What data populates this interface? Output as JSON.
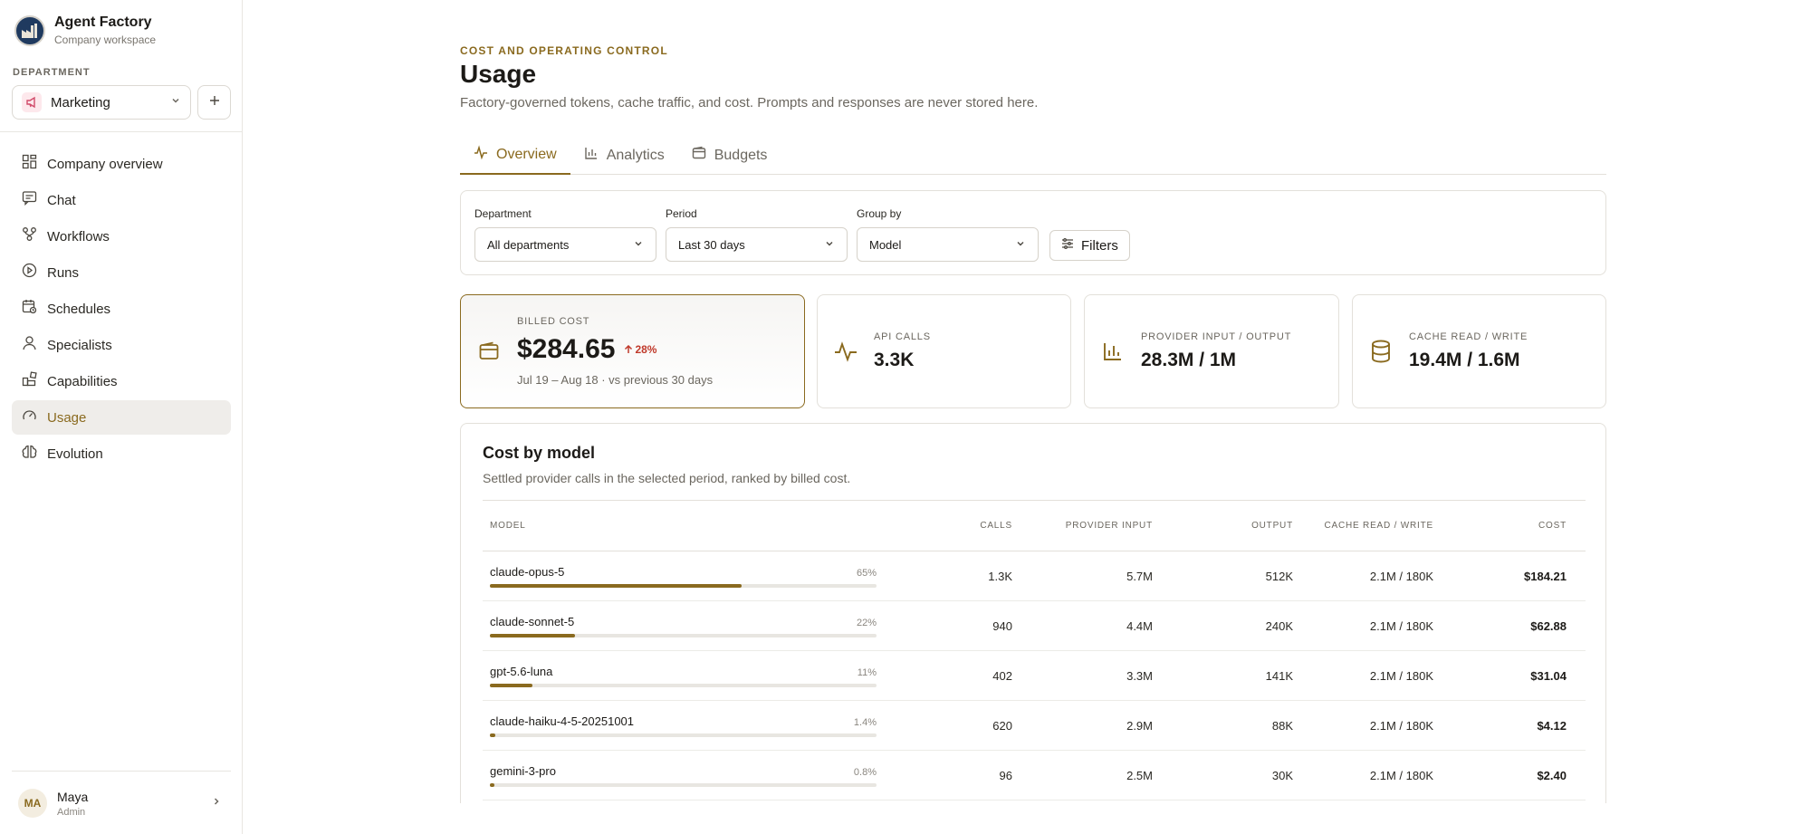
{
  "brand": {
    "name": "Agent Factory",
    "subtitle": "Company workspace"
  },
  "department": {
    "label": "DEPARTMENT",
    "selected": "Marketing"
  },
  "nav": [
    {
      "label": "Company overview",
      "icon": "grid-icon"
    },
    {
      "label": "Chat",
      "icon": "chat-icon"
    },
    {
      "label": "Workflows",
      "icon": "workflow-icon"
    },
    {
      "label": "Runs",
      "icon": "play-circle-icon"
    },
    {
      "label": "Schedules",
      "icon": "calendar-clock-icon"
    },
    {
      "label": "Specialists",
      "icon": "user-icon"
    },
    {
      "label": "Capabilities",
      "icon": "blocks-icon"
    },
    {
      "label": "Usage",
      "icon": "gauge-icon",
      "active": true
    },
    {
      "label": "Evolution",
      "icon": "brain-icon"
    }
  ],
  "user": {
    "initials": "MA",
    "name": "Maya",
    "role": "Admin"
  },
  "header": {
    "eyebrow": "COST AND OPERATING CONTROL",
    "title": "Usage",
    "subtitle": "Factory-governed tokens, cache traffic, and cost. Prompts and responses are never stored here."
  },
  "tabs": [
    {
      "label": "Overview",
      "icon": "activity-icon",
      "active": true
    },
    {
      "label": "Analytics",
      "icon": "bar-chart-icon"
    },
    {
      "label": "Budgets",
      "icon": "wallet-icon"
    }
  ],
  "filters": {
    "department": {
      "label": "Department",
      "value": "All departments"
    },
    "period": {
      "label": "Period",
      "value": "Last 30 days"
    },
    "group_by": {
      "label": "Group by",
      "value": "Model"
    },
    "button": "Filters"
  },
  "stats": {
    "billed": {
      "label": "BILLED COST",
      "value": "$284.65",
      "delta": "28%",
      "note": "Jul 19 – Aug 18 · vs previous 30 days"
    },
    "calls": {
      "label": "API CALLS",
      "value": "3.3K"
    },
    "provider": {
      "label": "PROVIDER INPUT / OUTPUT",
      "value": "28.3M / 1M"
    },
    "cache": {
      "label": "CACHE READ / WRITE",
      "value": "19.4M / 1.6M"
    }
  },
  "cost_table": {
    "title": "Cost by model",
    "subtitle": "Settled provider calls in the selected period, ranked by billed cost.",
    "columns": [
      "MODEL",
      "CALLS",
      "PROVIDER INPUT",
      "OUTPUT",
      "CACHE READ / WRITE",
      "COST"
    ],
    "rows": [
      {
        "model": "claude-opus-5",
        "share": "65%",
        "fill": 0.65,
        "calls": "1.3K",
        "input": "5.7M",
        "output": "512K",
        "cache": "2.1M / 180K",
        "cost": "$184.21"
      },
      {
        "model": "claude-sonnet-5",
        "share": "22%",
        "fill": 0.22,
        "calls": "940",
        "input": "4.4M",
        "output": "240K",
        "cache": "2.1M / 180K",
        "cost": "$62.88"
      },
      {
        "model": "gpt-5.6-luna",
        "share": "11%",
        "fill": 0.11,
        "calls": "402",
        "input": "3.3M",
        "output": "141K",
        "cache": "2.1M / 180K",
        "cost": "$31.04"
      },
      {
        "model": "claude-haiku-4-5-20251001",
        "share": "1.4%",
        "fill": 0.014,
        "calls": "620",
        "input": "2.9M",
        "output": "88K",
        "cache": "2.1M / 180K",
        "cost": "$4.12"
      },
      {
        "model": "gemini-3-pro",
        "share": "0.8%",
        "fill": 0.008,
        "calls": "96",
        "input": "2.5M",
        "output": "30K",
        "cache": "2.1M / 180K",
        "cost": "$2.40"
      }
    ]
  },
  "colors": {
    "accent": "#8a6a1f",
    "negative": "#c0392b",
    "border": "#e3e0da"
  }
}
